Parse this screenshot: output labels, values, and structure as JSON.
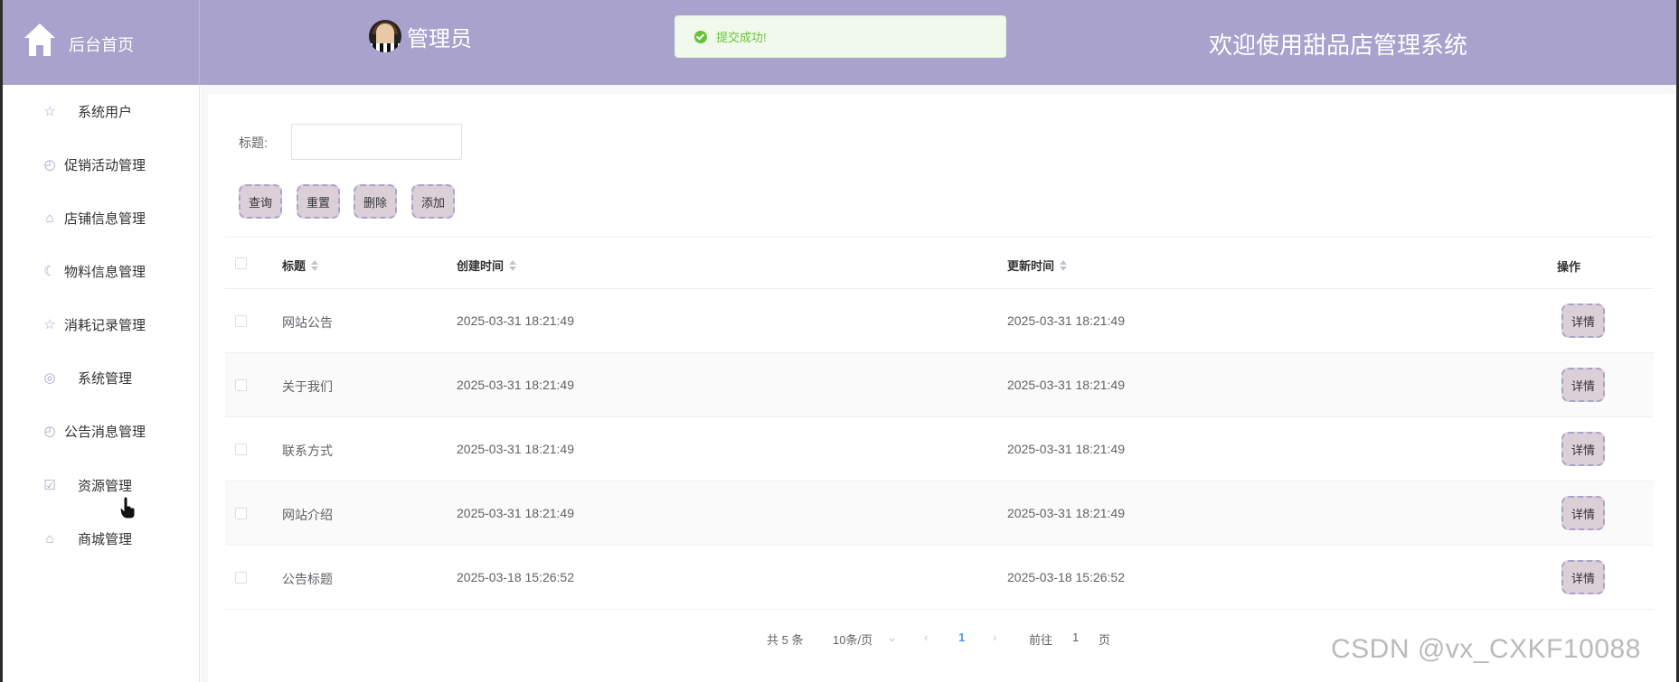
{
  "header": {
    "brand_label": "后台首页",
    "admin_label": "管理员",
    "welcome": "欢迎使用甜品店管理系统",
    "bg_color": "#a9a2cd"
  },
  "toast": {
    "text": "提交成功!",
    "icon": "success-check-icon"
  },
  "sidebar": {
    "items": [
      {
        "label": "系统用户",
        "icon": "star-icon"
      },
      {
        "label": "促销活动管理",
        "icon": "clock-icon"
      },
      {
        "label": "店铺信息管理",
        "icon": "shop-icon"
      },
      {
        "label": "物料信息管理",
        "icon": "moon-icon"
      },
      {
        "label": "消耗记录管理",
        "icon": "star-icon"
      },
      {
        "label": "系统管理",
        "icon": "compass-icon"
      },
      {
        "label": "公告消息管理",
        "icon": "clock-icon"
      },
      {
        "label": "资源管理",
        "icon": "calendar-check-icon"
      },
      {
        "label": "商城管理",
        "icon": "shop-icon"
      }
    ]
  },
  "search": {
    "label": "标题:",
    "value": ""
  },
  "buttons": {
    "query": "查询",
    "reset": "重置",
    "delete": "删除",
    "add": "添加"
  },
  "table": {
    "headers": {
      "title": "标题",
      "created": "创建时间",
      "updated": "更新时间",
      "actions": "操作"
    },
    "rows": [
      {
        "title": "网站公告",
        "created": "2025-03-31 18:21:49",
        "updated": "2025-03-31 18:21:49",
        "action": "详情"
      },
      {
        "title": "关于我们",
        "created": "2025-03-31 18:21:49",
        "updated": "2025-03-31 18:21:49",
        "action": "详情"
      },
      {
        "title": "联系方式",
        "created": "2025-03-31 18:21:49",
        "updated": "2025-03-31 18:21:49",
        "action": "详情"
      },
      {
        "title": "网站介绍",
        "created": "2025-03-31 18:21:49",
        "updated": "2025-03-31 18:21:49",
        "action": "详情"
      },
      {
        "title": "公告标题",
        "created": "2025-03-18 15:26:52",
        "updated": "2025-03-18 15:26:52",
        "action": "详情"
      }
    ]
  },
  "pagination": {
    "total": "共 5 条",
    "page_size": "10条/页",
    "current_page": "1",
    "goto_prefix": "前往",
    "goto_value": "1",
    "goto_suffix": "页",
    "active_color": "#409eff"
  },
  "watermark": "CSDN @vx_CXKF10088"
}
